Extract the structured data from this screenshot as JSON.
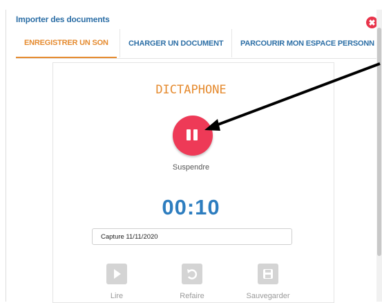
{
  "dialog": {
    "title": "Importer des documents",
    "close_glyph": "✖"
  },
  "tabs": [
    {
      "label": "ENREGISTRER UN SON",
      "active": true
    },
    {
      "label": "CHARGER UN DOCUMENT",
      "active": false
    },
    {
      "label": "PARCOURIR MON ESPACE PERSONN",
      "active": false
    }
  ],
  "recorder": {
    "heading": "DICTAPHONE",
    "state_label": "Suspendre",
    "timer": "00:10",
    "filename_value": "Capture 11/11/2020"
  },
  "controls": [
    {
      "label": "Lire",
      "icon": "play-icon"
    },
    {
      "label": "Refaire",
      "icon": "undo-icon"
    },
    {
      "label": "Sauvegarder",
      "icon": "save-icon"
    }
  ],
  "colors": {
    "accent": "#e58a2e",
    "link": "#2d6fa6",
    "record": "#ee3a57",
    "timer": "#2d7dbf"
  }
}
